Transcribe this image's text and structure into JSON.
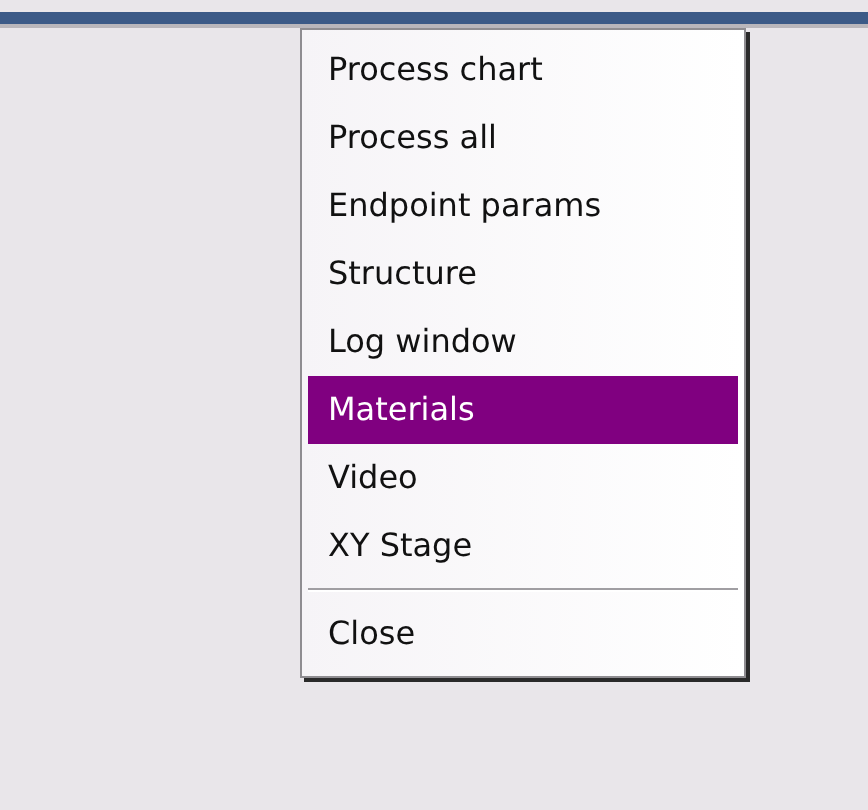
{
  "context_menu": {
    "items": [
      {
        "kind": "item",
        "label": "Process chart",
        "selected": false
      },
      {
        "kind": "item",
        "label": "Process all",
        "selected": false
      },
      {
        "kind": "item",
        "label": "Endpoint params",
        "selected": false
      },
      {
        "kind": "item",
        "label": "Structure",
        "selected": false
      },
      {
        "kind": "item",
        "label": "Log window",
        "selected": false
      },
      {
        "kind": "item",
        "label": "Materials",
        "selected": true
      },
      {
        "kind": "item",
        "label": "Video",
        "selected": false
      },
      {
        "kind": "item",
        "label": "XY Stage",
        "selected": false
      },
      {
        "kind": "separator"
      },
      {
        "kind": "item",
        "label": "Close",
        "selected": false
      }
    ]
  }
}
